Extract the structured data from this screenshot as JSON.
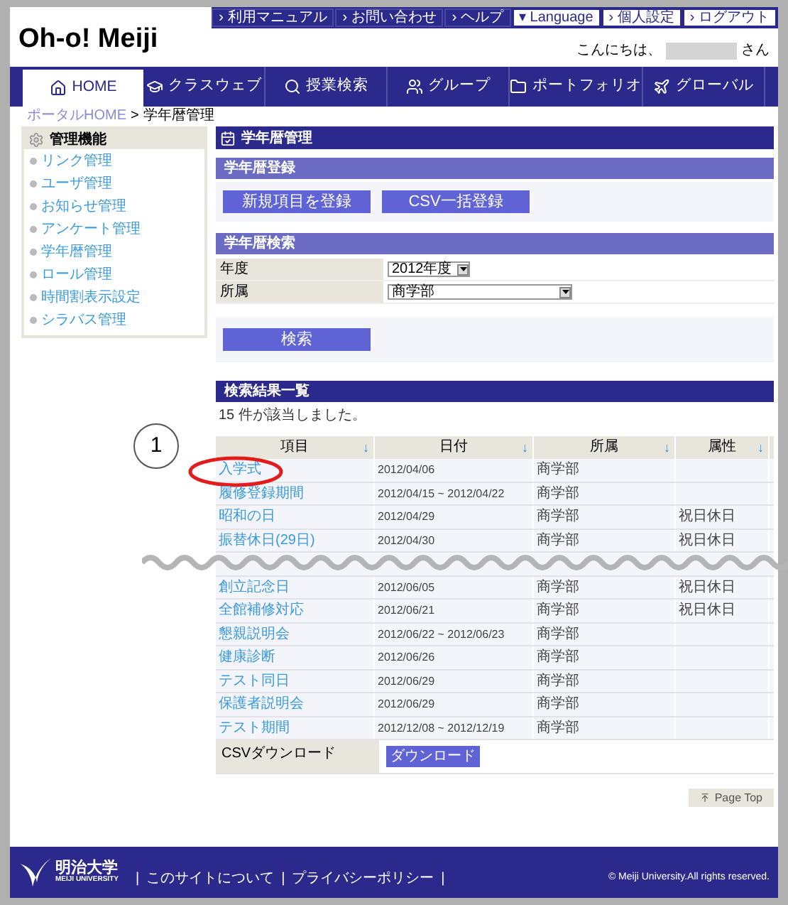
{
  "header": {
    "logo": "Oh-o! Meiji",
    "links": [
      {
        "label": "› 利用マニュアル",
        "kind": "dark"
      },
      {
        "label": "› お問い合わせ",
        "kind": "dark"
      },
      {
        "label": "› ヘルプ",
        "kind": "dark"
      },
      {
        "label": "▾ Language",
        "kind": "light"
      },
      {
        "label": "› 個人設定",
        "kind": "light"
      },
      {
        "label": "› ログアウト",
        "kind": "light"
      }
    ],
    "greeting": "こんにちは、",
    "greeting_suffix": "さん"
  },
  "nav": [
    {
      "label": "HOME",
      "selected": true
    },
    {
      "label": "クラスウェブ",
      "selected": false
    },
    {
      "label": "授業検索",
      "selected": false
    },
    {
      "label": "グループ",
      "selected": false
    },
    {
      "label": "ポートフォリオ",
      "selected": false
    },
    {
      "label": "グローバル",
      "selected": false
    }
  ],
  "breadcrumb": {
    "link": "ポータルHOME",
    "separator": ">",
    "current": "学年暦管理"
  },
  "sidebar": {
    "title": "管理機能",
    "items": [
      "リンク管理",
      "ユーザ管理",
      "お知らせ管理",
      "アンケート管理",
      "学年暦管理",
      "ロール管理",
      "時間割表示設定",
      "シラバス管理"
    ]
  },
  "page_title": "学年暦管理",
  "register": {
    "title": "学年暦登録",
    "buttons": [
      "新規項目を登録",
      "CSV一括登録"
    ]
  },
  "search": {
    "title": "学年暦検索",
    "fields": [
      {
        "label": "年度",
        "value": "2012年度"
      },
      {
        "label": "所属",
        "value": "商学部"
      }
    ],
    "button": "検索"
  },
  "results": {
    "title": "検索結果一覧",
    "count": "15 件が該当しました。",
    "columns": [
      "項目",
      "日付",
      "所属",
      "属性"
    ],
    "sort_icon": "↓",
    "rows": [
      {
        "kind": "row",
        "cells": [
          "入学式",
          "2012/04/06",
          "商学部",
          ""
        ]
      },
      {
        "kind": "row",
        "cells": [
          "履修登録期間",
          "2012/04/15 ~ 2012/04/22",
          "商学部",
          ""
        ]
      },
      {
        "kind": "row",
        "cells": [
          "昭和の日",
          "2012/04/29",
          "商学部",
          "祝日休日"
        ]
      },
      {
        "kind": "row",
        "cells": [
          "振替休日(29日)",
          "2012/04/30",
          "商学部",
          "祝日休日"
        ]
      },
      {
        "kind": "break",
        "cells": []
      },
      {
        "kind": "row",
        "cells": [
          "創立記念日",
          "2012/06/05",
          "商学部",
          "祝日休日"
        ]
      },
      {
        "kind": "row",
        "cells": [
          "全館補修対応",
          "2012/06/21",
          "商学部",
          "祝日休日"
        ]
      },
      {
        "kind": "row",
        "cells": [
          "懇親説明会",
          "2012/06/22 ~ 2012/06/23",
          "商学部",
          ""
        ]
      },
      {
        "kind": "row",
        "cells": [
          "健康診断",
          "2012/06/26",
          "商学部",
          ""
        ]
      },
      {
        "kind": "row",
        "cells": [
          "テスト同日",
          "2012/06/29",
          "商学部",
          ""
        ]
      },
      {
        "kind": "row",
        "cells": [
          "保護者説明会",
          "2012/06/29",
          "商学部",
          ""
        ]
      },
      {
        "kind": "row",
        "cells": [
          "テスト期間",
          "2012/12/08 ~ 2012/12/19",
          "商学部",
          ""
        ]
      }
    ],
    "csv_label": "CSVダウンロード",
    "csv_button": "ダウンロード"
  },
  "page_top": "Page Top",
  "annotation": {
    "marker": "1"
  },
  "footer": {
    "logo_name": "明治大学",
    "logo_sub": "MEIJI UNIVERSITY",
    "separator": "|",
    "links": [
      "このサイトについて",
      "プライバシーポリシー"
    ],
    "copyright": "© Meiji University.All rights reserved."
  }
}
